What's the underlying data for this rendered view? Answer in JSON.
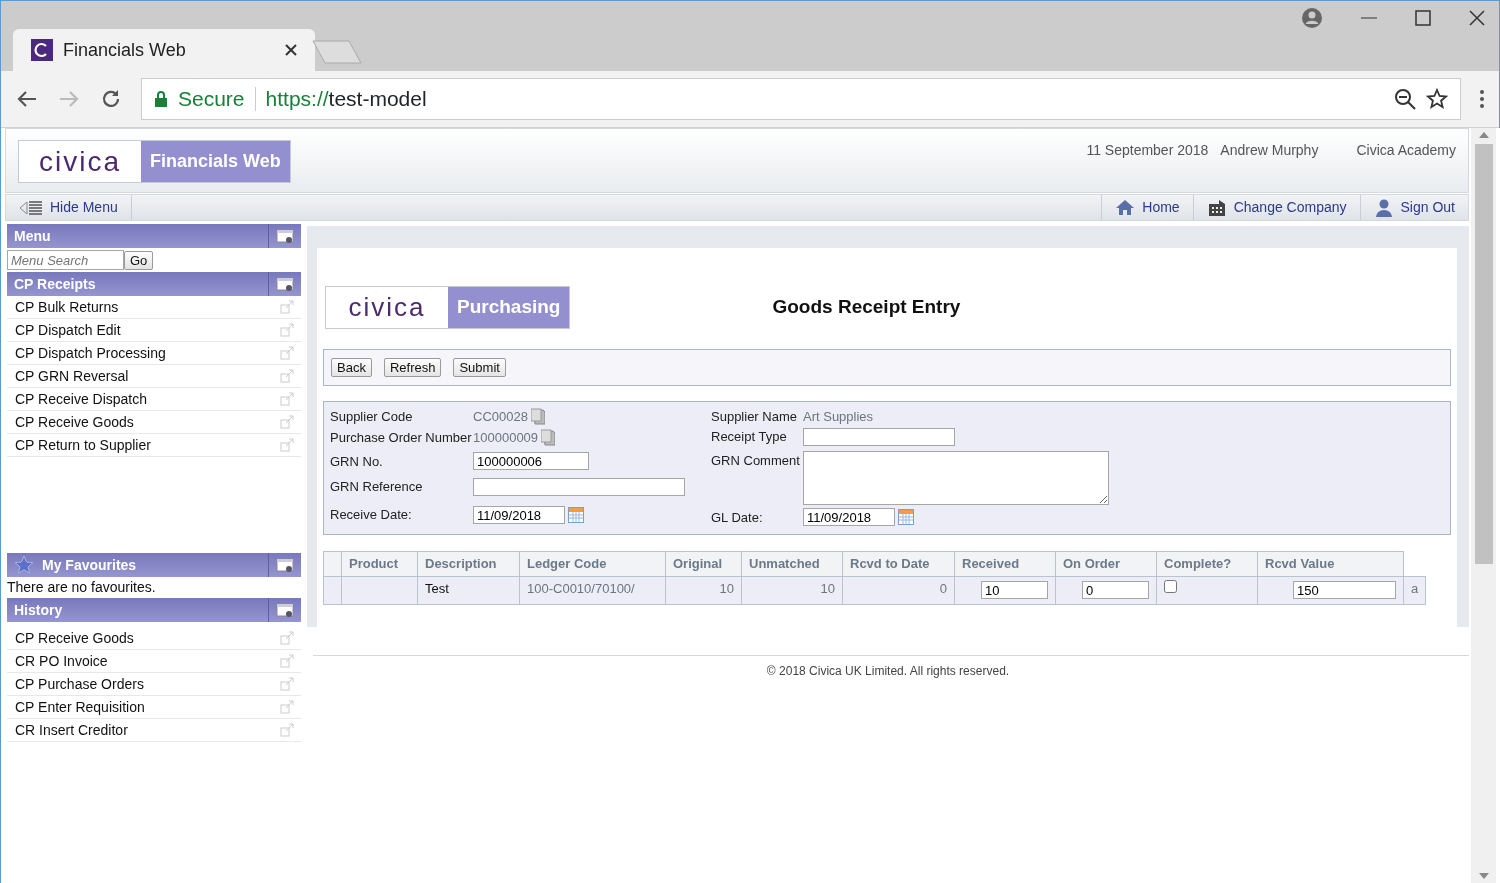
{
  "browser": {
    "tab_title": "Financials Web",
    "secure_label": "Secure",
    "scheme": "https://",
    "host": "test-model"
  },
  "header": {
    "logo": "civica",
    "product": "Financials Web",
    "date": "11 September 2018",
    "user": "Andrew Murphy",
    "organisation": "Civica Academy"
  },
  "nav": {
    "hide_menu": "Hide Menu",
    "links": [
      {
        "label": "Home",
        "kind": "home"
      },
      {
        "label": "Change Company",
        "kind": "company"
      },
      {
        "label": "Sign Out",
        "kind": "signout"
      }
    ]
  },
  "sidebar": {
    "menu": {
      "title": "Menu",
      "search_placeholder": "Menu Search",
      "go": "Go"
    },
    "section": {
      "title": "CP Receipts",
      "items": [
        "CP Bulk Returns",
        "CP Dispatch Edit",
        "CP Dispatch Processing",
        "CP GRN Reversal",
        "CP Receive Dispatch",
        "CP Receive Goods",
        "CP Return to Supplier"
      ]
    },
    "favourites": {
      "title": "My Favourites",
      "empty_text": "There are no favourites."
    },
    "history": {
      "title": "History",
      "items": [
        "CP Receive Goods",
        "CR PO Invoice",
        "CP Purchase Orders",
        "CP Enter Requisition",
        "CR Insert Creditor"
      ]
    }
  },
  "main": {
    "logo": "civica",
    "product": "Purchasing",
    "title": "Goods Receipt Entry",
    "buttons": [
      "Back",
      "Refresh",
      "Submit"
    ],
    "form_left": [
      {
        "label": "Supplier Code",
        "kind": "lookup",
        "value": "CC00028"
      },
      {
        "label": "Purchase Order Number",
        "kind": "lookup",
        "value": "100000009"
      },
      {
        "label": "GRN No.",
        "kind": "input",
        "value": "100000006"
      },
      {
        "label": "GRN Reference",
        "kind": "wide"
      },
      {
        "label": "Receive Date:",
        "kind": "date",
        "value": "11/09/2018"
      }
    ],
    "form_right": [
      {
        "label": "Supplier Name",
        "kind": "text",
        "value": "Art Supplies"
      },
      {
        "label": "Receipt Type",
        "kind": "input"
      },
      {
        "label": "GRN Comment",
        "kind": "textarea"
      },
      {
        "label": "GL Date:",
        "kind": "date",
        "value": "11/09/2018"
      }
    ],
    "table": {
      "columns": [
        "Product",
        "Description",
        "Ledger Code",
        "Original",
        "Unmatched",
        "Rcvd to Date",
        "Received",
        "On Order",
        "Complete?",
        "Rcvd Value"
      ],
      "rows": [
        {
          "product": "",
          "description": "Test",
          "ledger_code": "100-C0010/70100/",
          "original": "10",
          "unmatched": "10",
          "rcvd_to_date": "0",
          "received": "10",
          "on_order": "0",
          "complete": false,
          "rcvd_value": "150",
          "column_11": "a"
        }
      ]
    }
  },
  "footer": "© 2018 Civica UK Limited. All rights reserved."
}
